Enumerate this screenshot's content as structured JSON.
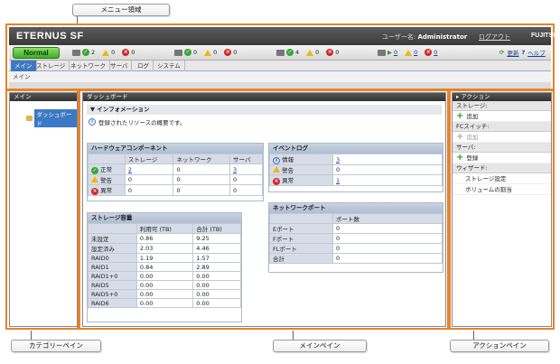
{
  "callouts": {
    "menu": "メニュー領域",
    "category": "カテゴリーペイン",
    "main": "メインペイン",
    "action": "アクションペイン"
  },
  "header": {
    "logo": "ETERNUS SF",
    "user_label": "ユーザー名:",
    "user_name": "Administrator",
    "logout": "ログアウト",
    "vendor": "FUJITSU"
  },
  "status": {
    "overall": "Normal",
    "storage": {
      "ok": "2",
      "warn": "0",
      "err": "0"
    },
    "switch": {
      "ok": "0",
      "warn": "0",
      "err": "0"
    },
    "server": {
      "ok": "4",
      "warn": "0",
      "err": "0"
    },
    "tasks": {
      "run": "0",
      "warn": "0",
      "err": "0"
    },
    "refresh": "更新",
    "help": "ヘルプ"
  },
  "tabs": [
    "メイン",
    "ストレージ",
    "ネットワーク",
    "サーバ",
    "ログ",
    "システム"
  ],
  "breadcrumb": "メイン",
  "category": {
    "title": "メイン",
    "item": "ダッシュボード"
  },
  "main": {
    "title": "ダッシュボード",
    "info_title": "インフォメーション",
    "info_text": "登録されたリソースの概要です。",
    "hw": {
      "title": "ハードウェアコンポーネント",
      "cols": [
        "ストレージ",
        "ネットワーク",
        "サーバ"
      ],
      "rows": [
        {
          "label": "正常",
          "v": [
            "2",
            "0",
            "3"
          ]
        },
        {
          "label": "警告",
          "v": [
            "0",
            "0",
            "0"
          ]
        },
        {
          "label": "異常",
          "v": [
            "0",
            "0",
            "0"
          ]
        }
      ]
    },
    "events": {
      "title": "イベントログ",
      "rows": [
        {
          "label": "情報",
          "v": "3"
        },
        {
          "label": "警告",
          "v": "0"
        },
        {
          "label": "異常",
          "v": "1"
        }
      ]
    },
    "cap": {
      "title": "ストレージ容量",
      "cols": [
        "利用可 (TB)",
        "合計 (TB)"
      ],
      "rows": [
        {
          "label": "未設定",
          "v": [
            "0.86",
            "9.25"
          ]
        },
        {
          "label": "設定済み",
          "v": [
            "2.03",
            "4.46"
          ]
        },
        {
          "label": "RAID0",
          "v": [
            "1.19",
            "1.57"
          ]
        },
        {
          "label": "RAID1",
          "v": [
            "0.84",
            "2.89"
          ]
        },
        {
          "label": "RAID1+0",
          "v": [
            "0.00",
            "0.00"
          ]
        },
        {
          "label": "RAID5",
          "v": [
            "0.00",
            "0.00"
          ]
        },
        {
          "label": "RAID5+0",
          "v": [
            "0.00",
            "0.00"
          ]
        },
        {
          "label": "RAID6",
          "v": [
            "0.00",
            "0.00"
          ]
        }
      ]
    },
    "ports": {
      "title": "ネットワークポート",
      "col": "ポート数",
      "rows": [
        {
          "label": "Eポート",
          "v": "0"
        },
        {
          "label": "Fポート",
          "v": "0"
        },
        {
          "label": "FLポート",
          "v": "0"
        },
        {
          "label": "合計",
          "v": "0"
        }
      ]
    }
  },
  "action": {
    "title": "アクション",
    "storage": "ストレージ:",
    "add": "追加",
    "fc": "FCスイッチ:",
    "fc_add": "追加",
    "server": "サーバ:",
    "register": "登録",
    "wizard": "ウィザード:",
    "w1": "ストレージ設定",
    "w2": "ボリュームの割当"
  }
}
